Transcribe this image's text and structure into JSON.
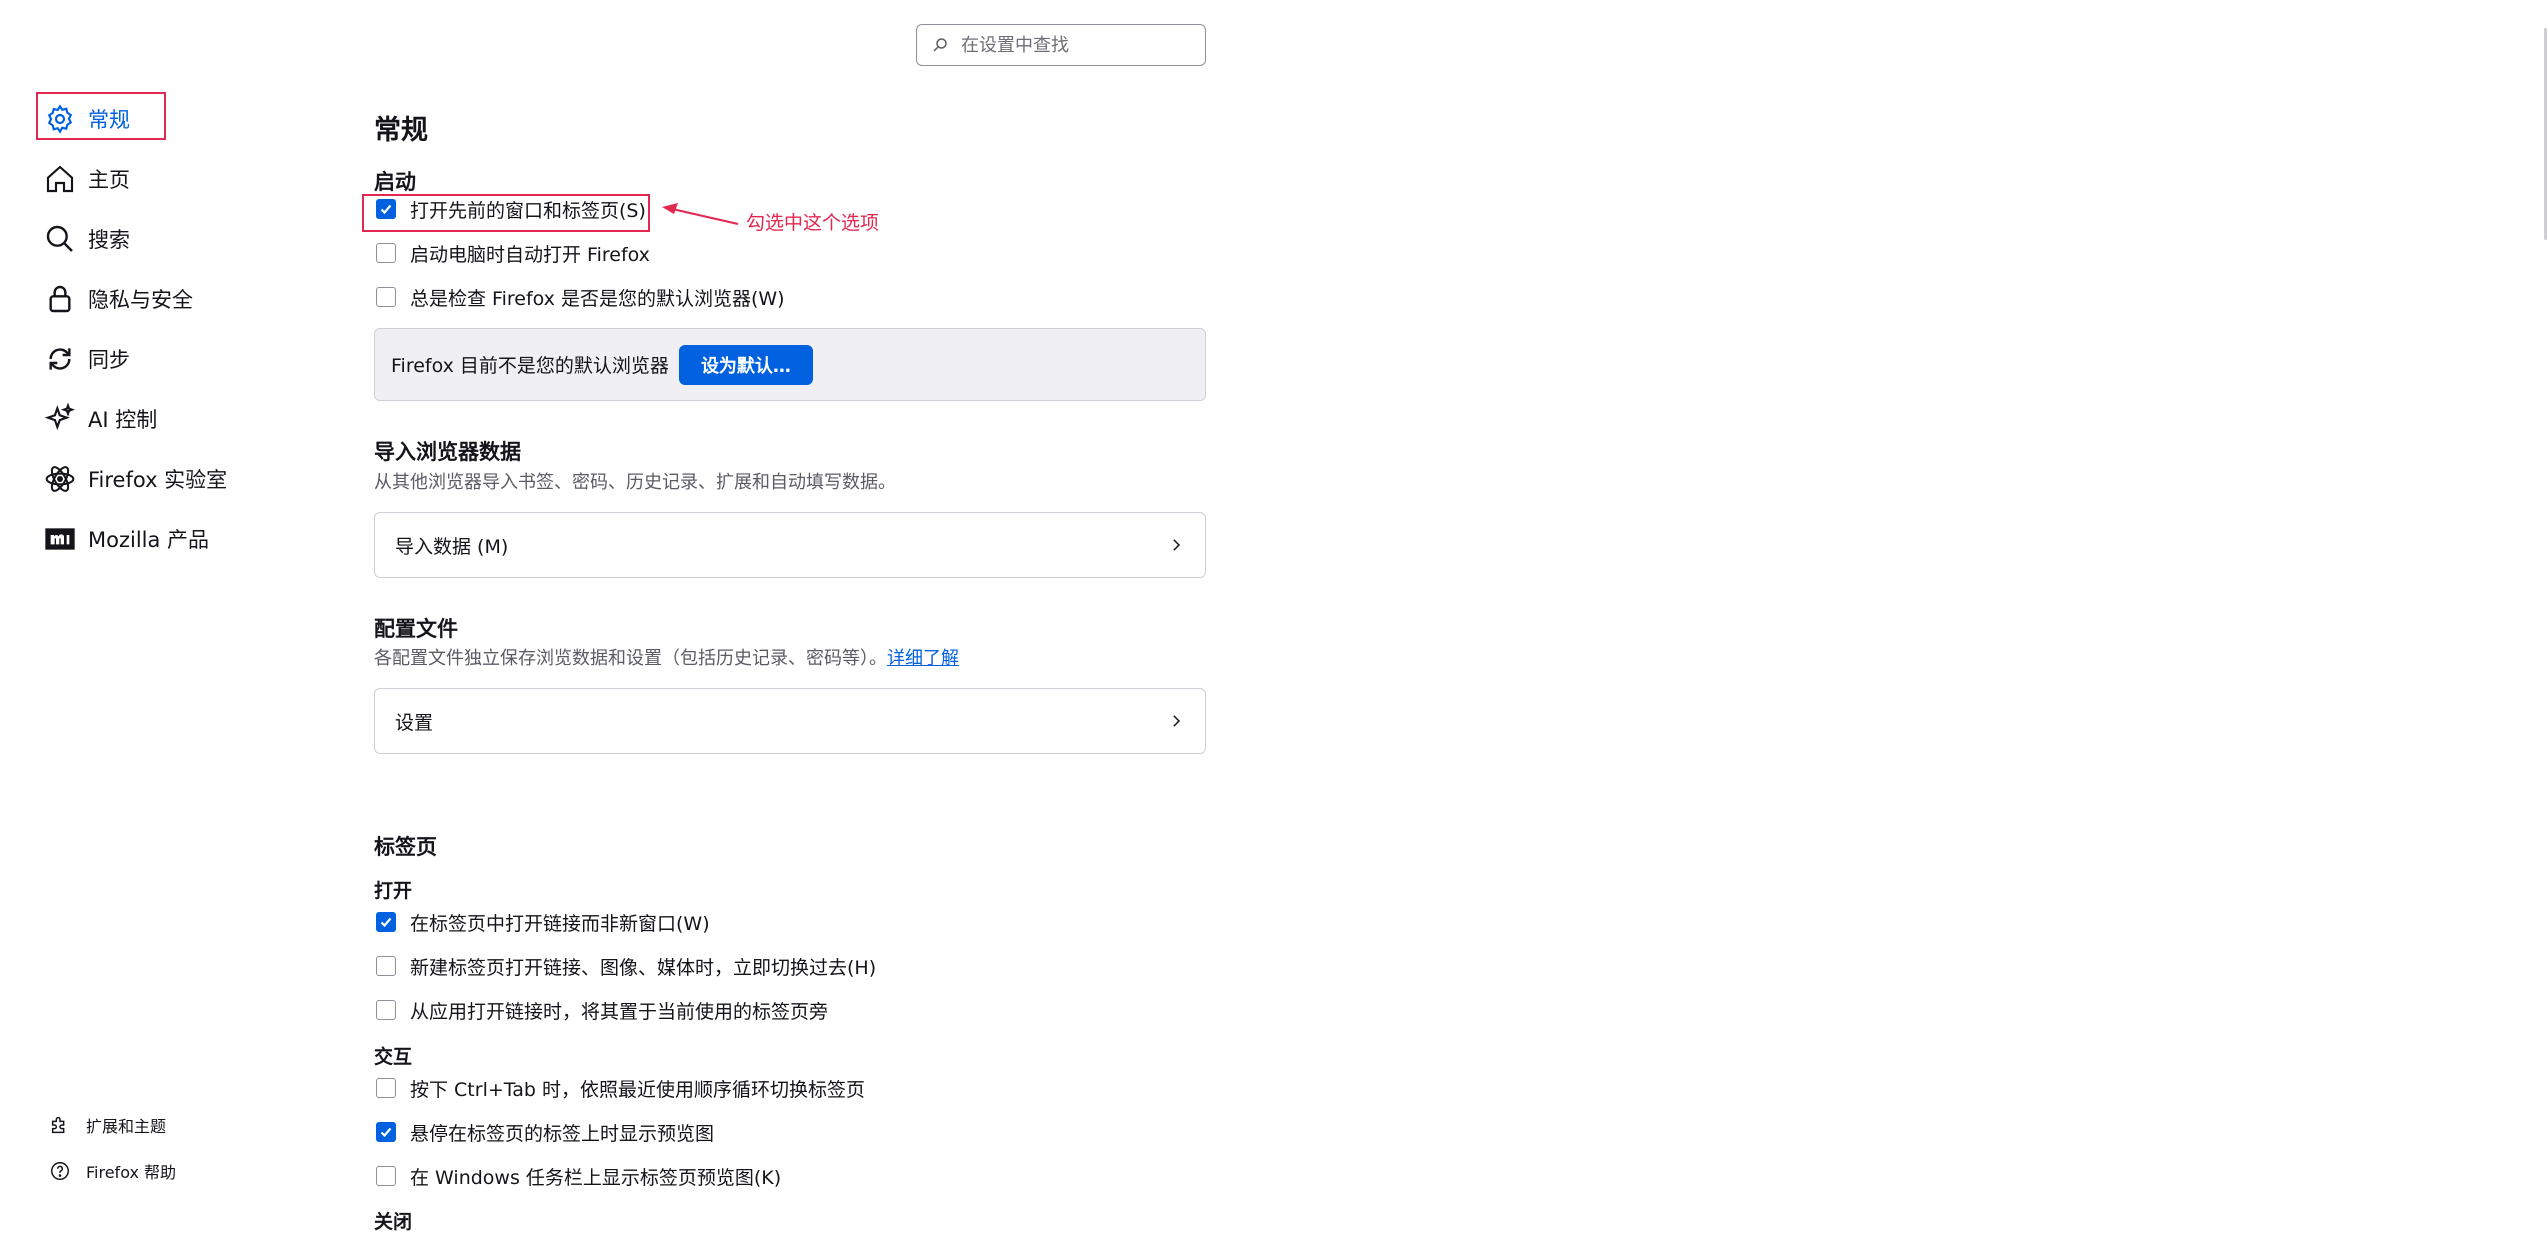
{
  "search": {
    "placeholder": "在设置中查找"
  },
  "sidebar": {
    "items": [
      {
        "label": "常规",
        "icon": "gear-icon",
        "active": true
      },
      {
        "label": "主页",
        "icon": "home-icon"
      },
      {
        "label": "搜索",
        "icon": "search-icon"
      },
      {
        "label": "隐私与安全",
        "icon": "lock-icon"
      },
      {
        "label": "同步",
        "icon": "sync-icon"
      },
      {
        "label": "AI 控制",
        "icon": "sparkle-icon"
      },
      {
        "label": "Firefox 实验室",
        "icon": "flask-icon"
      },
      {
        "label": "Mozilla 产品",
        "icon": "mozilla-logo-icon"
      }
    ],
    "footer": [
      {
        "label": "扩展和主题",
        "icon": "puzzle-icon"
      },
      {
        "label": "Firefox 帮助",
        "icon": "help-icon"
      }
    ]
  },
  "main": {
    "title": "常规",
    "startup": {
      "heading": "启动",
      "options": [
        {
          "label": "打开先前的窗口和标签页(S)",
          "checked": true
        },
        {
          "label": "启动电脑时自动打开 Firefox",
          "checked": false
        },
        {
          "label": "总是检查 Firefox 是否是您的默认浏览器(W)",
          "checked": false
        }
      ],
      "default_notice": "Firefox 目前不是您的默认浏览器",
      "default_button": "设为默认…"
    },
    "import": {
      "heading": "导入浏览器数据",
      "description": "从其他浏览器导入书签、密码、历史记录、扩展和自动填写数据。",
      "button": "导入数据 (M)"
    },
    "profiles": {
      "heading": "配置文件",
      "description": "各配置文件独立保存浏览数据和设置（包括历史记录、密码等）。",
      "learn_more": "详细了解",
      "button": "设置"
    },
    "tabs": {
      "heading": "标签页",
      "open_heading": "打开",
      "open_options": [
        {
          "label": "在标签页中打开链接而非新窗口(W)",
          "checked": true
        },
        {
          "label": "新建标签页打开链接、图像、媒体时，立即切换过去(H)",
          "checked": false
        },
        {
          "label": "从应用打开链接时，将其置于当前使用的标签页旁",
          "checked": false
        }
      ],
      "interact_heading": "交互",
      "interact_options": [
        {
          "label": "按下 Ctrl+Tab 时，依照最近使用顺序循环切换标签页",
          "checked": false
        },
        {
          "label": "悬停在标签页的标签上时显示预览图",
          "checked": true
        },
        {
          "label": "在 Windows 任务栏上显示标签页预览图(K)",
          "checked": false
        }
      ],
      "close_heading": "关闭"
    }
  },
  "annotation": {
    "text": "勾选中这个选项"
  },
  "colors": {
    "accent": "#0061e0",
    "annotation": "#e22850",
    "text": "#15141a"
  }
}
